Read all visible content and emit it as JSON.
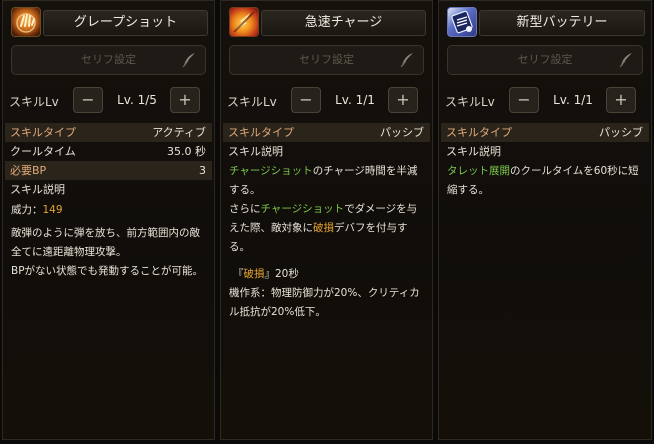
{
  "cards": [
    {
      "title": "グレープショット",
      "icon": "grapeshot-hand-icon",
      "serif_label": "セリフ設定",
      "lv_label": "スキルLv",
      "lv_value": "Lv. 1/5",
      "minus": "−",
      "plus": "+",
      "rows": [
        {
          "key": "スキルタイプ",
          "value": "アクティブ"
        },
        {
          "key": "クールタイム",
          "value": "35.0 秒"
        },
        {
          "key": "必要BP",
          "value": "3"
        },
        {
          "key": "スキル説明",
          "value": ""
        }
      ],
      "power_label": "威力：",
      "power_value": "149",
      "desc1": "敵弾のように弾を放ち、前方範囲内の敵全てに遠距離物理攻撃。",
      "desc2": "BPがない状態でも発動することが可能。"
    },
    {
      "title": "急速チャージ",
      "icon": "rapid-charge-icon",
      "serif_label": "セリフ設定",
      "lv_label": "スキルLv",
      "lv_value": "Lv. 1/1",
      "minus": "−",
      "plus": "+",
      "rows": [
        {
          "key": "スキルタイプ",
          "value": "パッシブ"
        },
        {
          "key": "スキル説明",
          "value": ""
        }
      ],
      "desc": {
        "a1": "チャージショット",
        "a2": "のチャージ時間を半減する。",
        "b0": "さらに",
        "b1": "チャージショット",
        "b2": "でダメージを与えた際、敵対象に",
        "b3": "破損",
        "b4": "デバフを付与する。",
        "c0": "『",
        "c1": "破損",
        "c2": "』20秒",
        "d": "機作系：物理防御力が20%、クリティカル抵抗が20%低下。"
      }
    },
    {
      "title": "新型バッテリー",
      "icon": "battery-icon",
      "serif_label": "セリフ設定",
      "lv_label": "スキルLv",
      "lv_value": "Lv. 1/1",
      "minus": "−",
      "plus": "+",
      "rows": [
        {
          "key": "スキルタイプ",
          "value": "パッシブ"
        },
        {
          "key": "スキル説明",
          "value": ""
        }
      ],
      "desc": {
        "a1": "タレット展開",
        "a2": "のクールタイムを60秒に短縮する。"
      }
    }
  ]
}
